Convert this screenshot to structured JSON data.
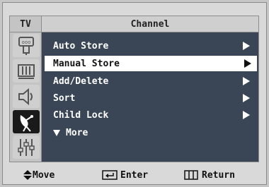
{
  "header": {
    "tv_label": "TV",
    "title": "Channel"
  },
  "sidebar": {
    "items": [
      {
        "icon": "picture-icon",
        "active": false
      },
      {
        "icon": "sound-icon",
        "active": false
      },
      {
        "icon": "speaker-icon",
        "active": false
      },
      {
        "icon": "satellite-dish-icon",
        "active": true
      },
      {
        "icon": "equalizer-sliders-icon",
        "active": false
      }
    ]
  },
  "menu": {
    "items": [
      {
        "label": "Auto Store",
        "has_arrow": true,
        "selected": false
      },
      {
        "label": "Manual Store",
        "has_arrow": true,
        "selected": true
      },
      {
        "label": "Add/Delete",
        "has_arrow": true,
        "selected": false
      },
      {
        "label": "Sort",
        "has_arrow": true,
        "selected": false
      },
      {
        "label": "Child Lock",
        "has_arrow": true,
        "selected": false
      }
    ],
    "more_label": "More"
  },
  "footer": {
    "move": "Move",
    "enter": "Enter",
    "return": "Return"
  },
  "colors": {
    "content_bg": "#3a4656",
    "selected_bg": "#ffffff",
    "frame_bg": "#d9d9d9"
  }
}
